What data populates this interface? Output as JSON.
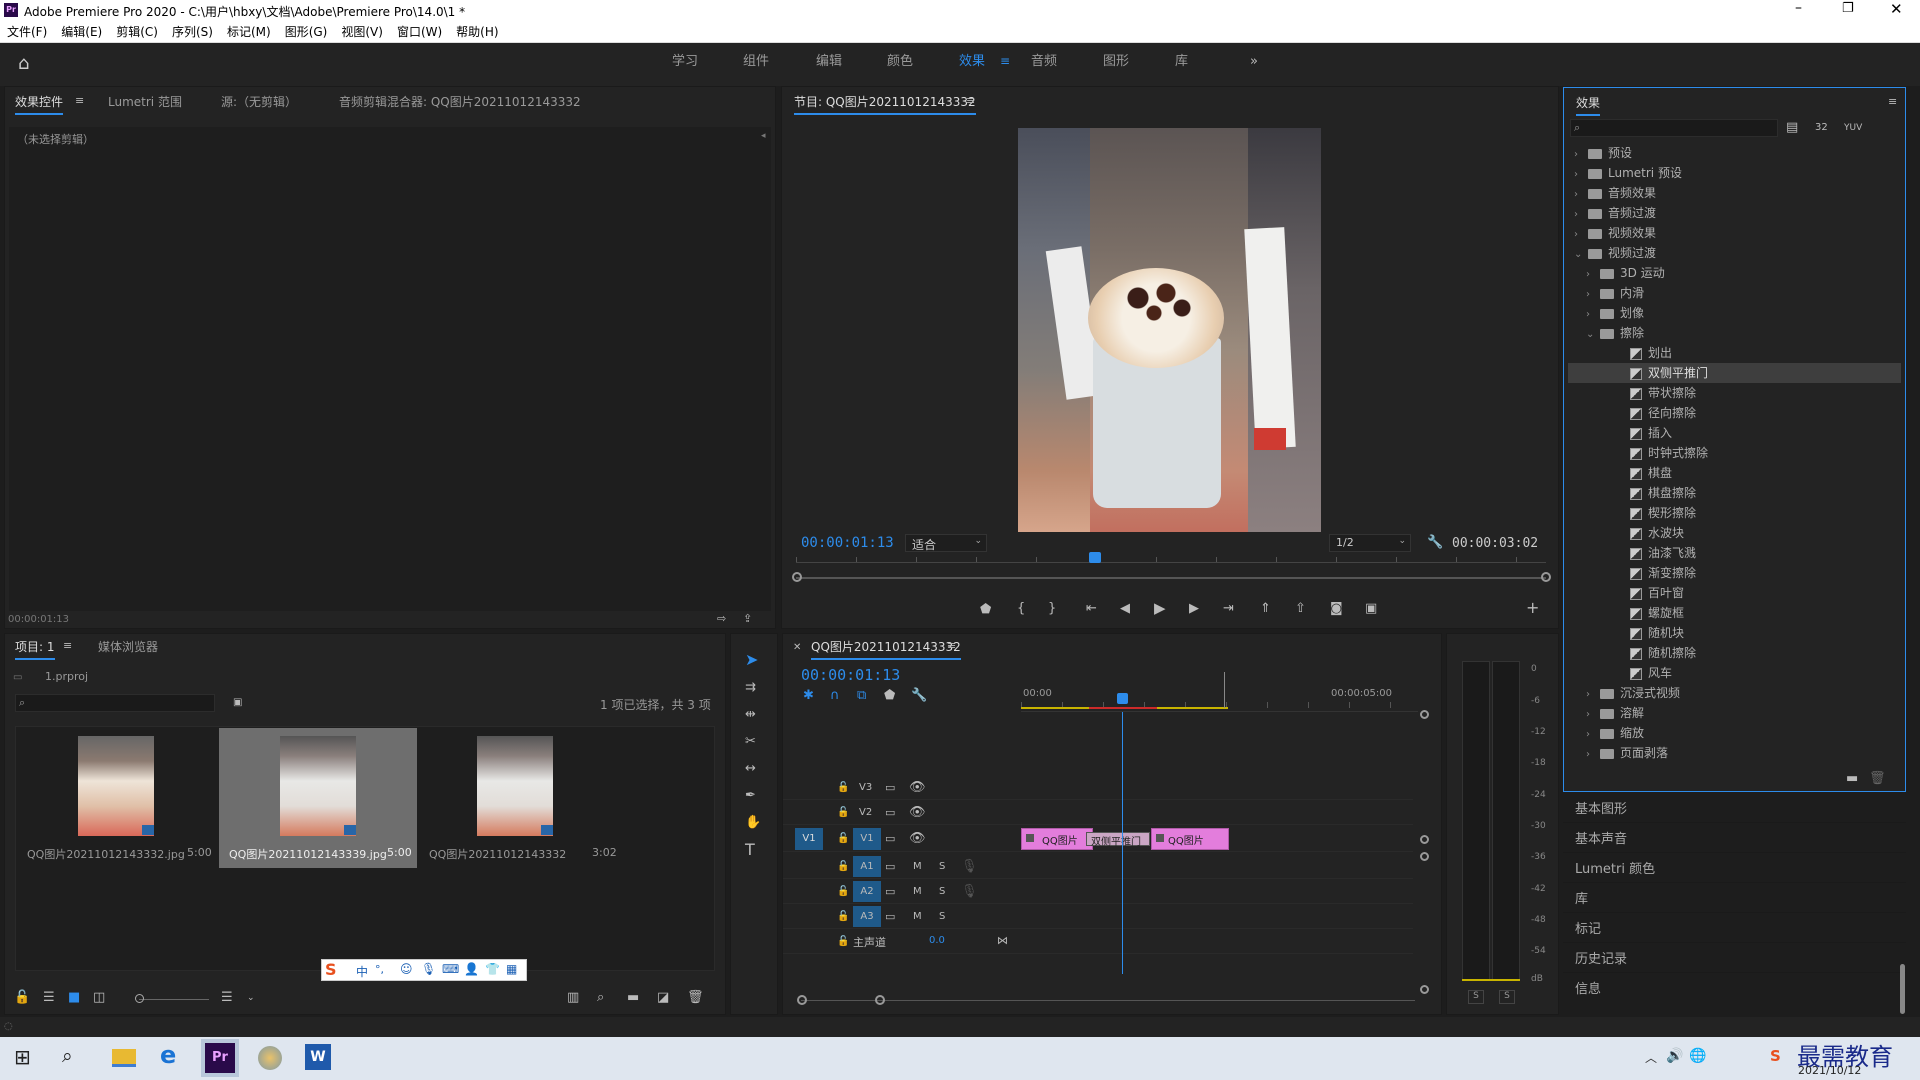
{
  "app": {
    "title": "Adobe Premiere Pro 2020 - C:\\用户\\hbxy\\文档\\Adobe\\Premiere Pro\\14.0\\1 *",
    "window_controls": [
      "minimize",
      "restore",
      "close"
    ]
  },
  "menu": [
    "文件(F)",
    "编辑(E)",
    "剪辑(C)",
    "序列(S)",
    "标记(M)",
    "图形(G)",
    "视图(V)",
    "窗口(W)",
    "帮助(H)"
  ],
  "workspaces": {
    "items": [
      "学习",
      "组件",
      "编辑",
      "颜色",
      "效果",
      "音频",
      "图形",
      "库"
    ],
    "active": "效果",
    "more": "»"
  },
  "source_panel": {
    "tabs": [
      "效果控件",
      "Lumetri 范围",
      "源:（无剪辑）",
      "音频剪辑混合器: QQ图片20211012143332"
    ],
    "message": "（未选择剪辑）",
    "timecode": "00:00:01:13"
  },
  "program": {
    "title": "节目: QQ图片20211012143332",
    "timecode": "00:00:01:13",
    "fit": "适合",
    "resolution": "1/2",
    "duration": "00:00:03:02"
  },
  "project": {
    "tabs": [
      "项目: 1",
      "媒体浏览器"
    ],
    "file": "1.prproj",
    "selection_info": "1 项已选择，共 3 项",
    "items": [
      {
        "name": "QQ图片20211012143332.jpg",
        "duration": "5:00"
      },
      {
        "name": "QQ图片20211012143339.jpg",
        "duration": "5:00"
      },
      {
        "name": "QQ图片20211012143332",
        "duration": "3:02"
      }
    ]
  },
  "timeline": {
    "title": "QQ图片20211012143332",
    "timecode": "00:00:01:13",
    "ruler": [
      "00:00",
      "00:00:05:00"
    ],
    "video_tracks": [
      "V3",
      "V2",
      "V1"
    ],
    "audio_tracks": [
      "A1",
      "A2",
      "A3"
    ],
    "master": "主声道",
    "master_value": "0.0",
    "source_patch": "V1",
    "clips": {
      "clip_a": "QQ图片",
      "transition": "双侧平推门",
      "clip_b": "QQ图片"
    },
    "track_buttons": [
      "M",
      "S"
    ]
  },
  "meter": {
    "scale": [
      "0",
      "-6",
      "-12",
      "-18",
      "-24",
      "-30",
      "-36",
      "-42",
      "-48",
      "-54",
      "dB"
    ],
    "solo": [
      "S",
      "S"
    ]
  },
  "effects": {
    "title": "效果",
    "tree": [
      {
        "label": "预设",
        "level": 0,
        "type": "folder",
        "open": false
      },
      {
        "label": "Lumetri 预设",
        "level": 0,
        "type": "folder",
        "open": false
      },
      {
        "label": "音频效果",
        "level": 0,
        "type": "folder",
        "open": false
      },
      {
        "label": "音频过渡",
        "level": 0,
        "type": "folder",
        "open": false
      },
      {
        "label": "视频效果",
        "level": 0,
        "type": "folder",
        "open": false
      },
      {
        "label": "视频过渡",
        "level": 0,
        "type": "folder",
        "open": true
      },
      {
        "label": "3D 运动",
        "level": 1,
        "type": "folder",
        "open": false
      },
      {
        "label": "内滑",
        "level": 1,
        "type": "folder",
        "open": false
      },
      {
        "label": "划像",
        "level": 1,
        "type": "folder",
        "open": false
      },
      {
        "label": "擦除",
        "level": 1,
        "type": "folder",
        "open": true
      },
      {
        "label": "划出",
        "level": 2,
        "type": "effect"
      },
      {
        "label": "双侧平推门",
        "level": 2,
        "type": "effect",
        "selected": true
      },
      {
        "label": "带状擦除",
        "level": 2,
        "type": "effect"
      },
      {
        "label": "径向擦除",
        "level": 2,
        "type": "effect"
      },
      {
        "label": "插入",
        "level": 2,
        "type": "effect"
      },
      {
        "label": "时钟式擦除",
        "level": 2,
        "type": "effect"
      },
      {
        "label": "棋盘",
        "level": 2,
        "type": "effect"
      },
      {
        "label": "棋盘擦除",
        "level": 2,
        "type": "effect"
      },
      {
        "label": "楔形擦除",
        "level": 2,
        "type": "effect"
      },
      {
        "label": "水波块",
        "level": 2,
        "type": "effect"
      },
      {
        "label": "油漆飞溅",
        "level": 2,
        "type": "effect"
      },
      {
        "label": "渐变擦除",
        "level": 2,
        "type": "effect"
      },
      {
        "label": "百叶窗",
        "level": 2,
        "type": "effect"
      },
      {
        "label": "螺旋框",
        "level": 2,
        "type": "effect"
      },
      {
        "label": "随机块",
        "level": 2,
        "type": "effect"
      },
      {
        "label": "随机擦除",
        "level": 2,
        "type": "effect"
      },
      {
        "label": "风车",
        "level": 2,
        "type": "effect"
      },
      {
        "label": "沉浸式视频",
        "level": 1,
        "type": "folder",
        "open": false
      },
      {
        "label": "溶解",
        "level": 1,
        "type": "folder",
        "open": false
      },
      {
        "label": "缩放",
        "level": 1,
        "type": "folder",
        "open": false
      },
      {
        "label": "页面剥落",
        "level": 1,
        "type": "folder",
        "open": false
      }
    ]
  },
  "side_panels": [
    "基本图形",
    "基本声音",
    "Lumetri 颜色",
    "库",
    "标记",
    "历史记录",
    "信息"
  ],
  "ime": {
    "labels": [
      "中",
      "°,"
    ]
  },
  "taskbar": {
    "date": "2021/10/12",
    "watermark": "最需教育"
  }
}
